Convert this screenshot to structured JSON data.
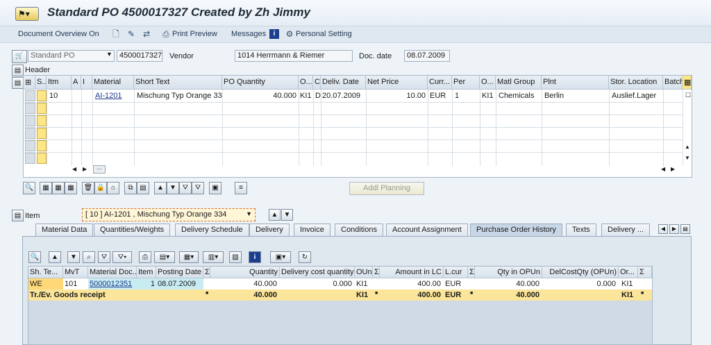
{
  "title": "Standard PO 4500017327 Created by Zh Jimmy",
  "toolbar": {
    "doc_overview": "Document Overview On",
    "print_preview": "Print Preview",
    "messages": "Messages",
    "personal_setting": "Personal Setting"
  },
  "header": {
    "doc_type": "Standard PO",
    "po_number": "4500017327",
    "vendor_label": "Vendor",
    "vendor_value": "1014 Herrmann & Riemer",
    "doc_date_label": "Doc. date",
    "doc_date_value": "08.07.2009",
    "header_label": "Header"
  },
  "item_table": {
    "columns": [
      "S..",
      "Itm",
      "A",
      "I",
      "Material",
      "Short Text",
      "PO Quantity",
      "O...",
      "C",
      "Deliv. Date",
      "Net Price",
      "Curr...",
      "Per",
      "O...",
      "Matl Group",
      "Plnt",
      "Stor. Location",
      "Batch"
    ],
    "row": {
      "itm": "10",
      "material": "AI-1201",
      "short_text": "Mischung Typ Orange 334",
      "po_quantity": "40.000",
      "oun": "KI1",
      "c": "D",
      "deliv_date": "20.07.2009",
      "net_price": "10.00",
      "curr": "EUR",
      "per": "1",
      "opu": "KI1",
      "matl_group": "Chemicals",
      "plnt": "Berlin",
      "stor_location": "Auslief.Lager"
    }
  },
  "addl_planning": "Addl Planning",
  "item_section": {
    "label": "Item",
    "selected": "[ 10 ] AI-1201 , Mischung Typ Orange 334"
  },
  "tabs": [
    "Material Data",
    "Quantities/Weights",
    "Delivery Schedule",
    "Delivery",
    "Invoice",
    "Conditions",
    "Account Assignment",
    "Purchase Order History",
    "Texts",
    "Delivery ..."
  ],
  "history_table": {
    "columns": [
      "Sh. Te...",
      "MvT",
      "Material Doc...",
      "Item",
      "Posting Date",
      "Σ",
      "Quantity",
      "Delivery cost quantity",
      "OUn",
      "Σ",
      "Amount in LC",
      "L.cur",
      "Σ",
      "Qty in OPUn",
      "DelCostQty (OPUn)",
      "Or...",
      "Σ"
    ],
    "row": {
      "sh_text": "WE",
      "mvt": "101",
      "mat_doc": "5000012351",
      "item": "1",
      "posting_date": "08.07.2009",
      "quantity": "40.000",
      "del_cost_qty": "0.000",
      "oun": "KI1",
      "amount_lc": "400.00",
      "lcur": "EUR",
      "qty_opun": "40.000",
      "delcost_opun": "0.000",
      "orun": "KI1"
    },
    "total": {
      "label": "Tr./Ev. Goods receipt",
      "quantity": "40.000",
      "oun": "KI1",
      "amount_lc": "400.00",
      "lcur": "EUR",
      "qty_opun": "40.000",
      "orun": "KI1"
    }
  }
}
